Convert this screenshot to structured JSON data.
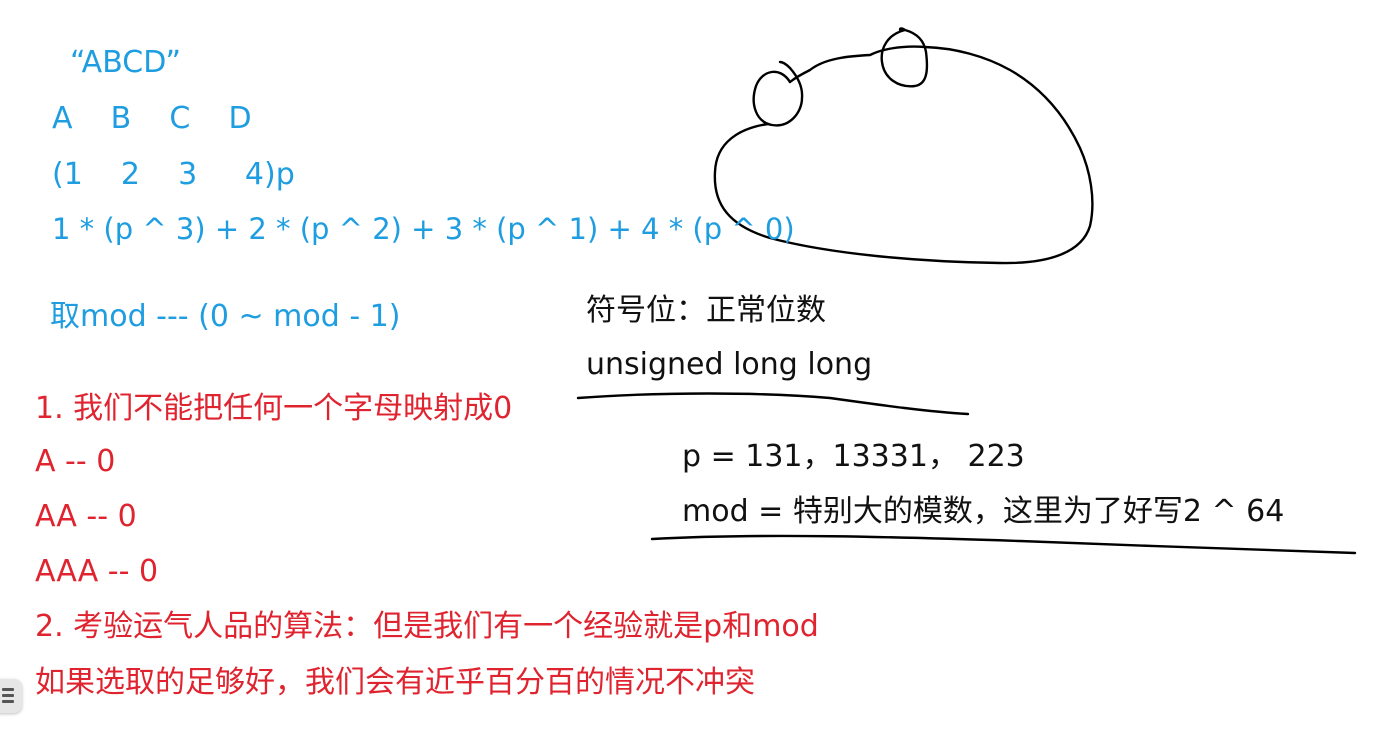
{
  "colors": {
    "blue_text": "#1e9de0",
    "red_text": "#e0242f",
    "black_text": "#111111",
    "ink": "#000000"
  },
  "blue_notes": {
    "string_literal": "“ABCD”",
    "letters": "A    B    C    D",
    "values": "(1    2    3     4)p",
    "formula": "1 * (p ^ 3) + 2 * (p ^ 2) + 3 * (p ^ 1) + 4 * (p ^ 0)",
    "mod_range": "取mod --- (0 ~ mod - 1)"
  },
  "black_notes": {
    "sign_bit": "符号位：正常位数",
    "ull": "unsigned long long",
    "p_values": "p = 131，13331， 223",
    "mod_value": "mod = 特别大的模数，这里为了好写2 ^ 64"
  },
  "red_notes": {
    "rule1": "1. 我们不能把任何一个字母映射成0",
    "a1": "A -- 0",
    "a2": "AA -- 0",
    "a3": "AAA -- 0",
    "rule2": "2. 考验运气人品的算法：但是我们有一个经验就是p和mod",
    "rule2_cont": "如果选取的足够好，我们会有近乎百分百的情况不冲突"
  },
  "icons": {
    "sketch": "cloud-sketch-icon",
    "toc": "list-icon"
  }
}
